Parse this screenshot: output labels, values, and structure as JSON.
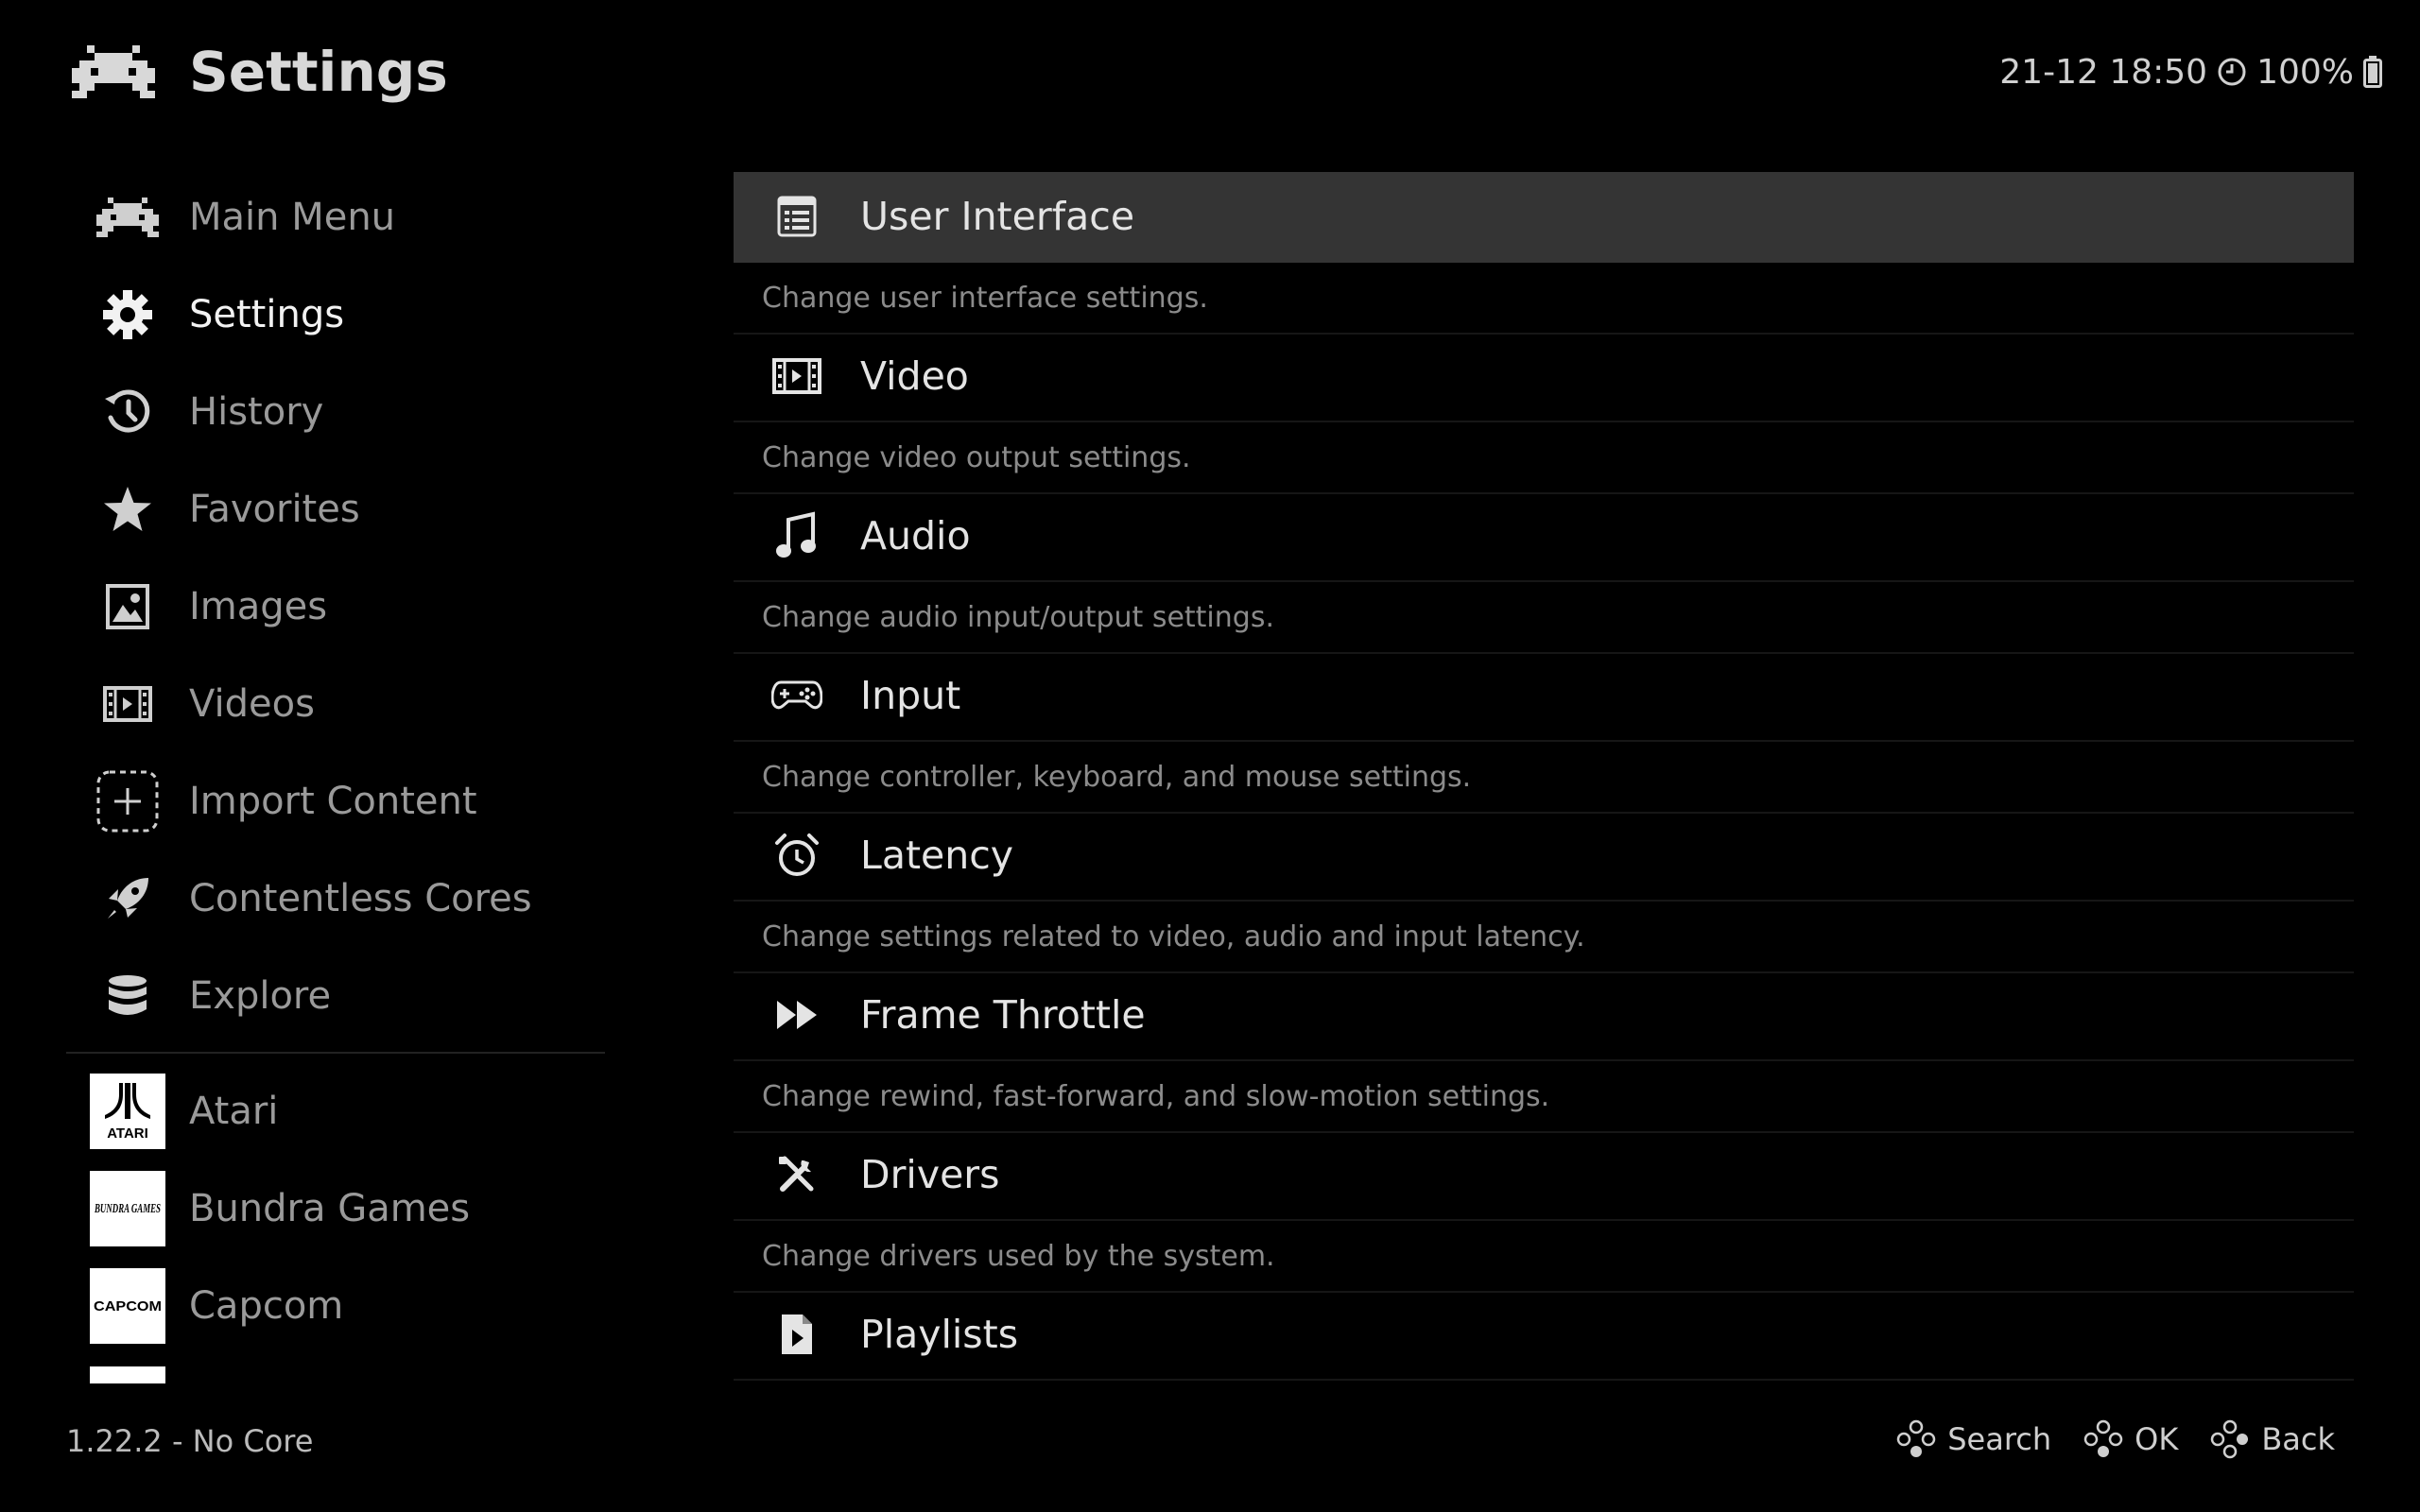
{
  "header": {
    "title": "Settings",
    "datetime": "21-12 18:50",
    "battery": "100%"
  },
  "sidebar": {
    "items": [
      {
        "label": "Main Menu",
        "icon": "invader-icon",
        "active": false
      },
      {
        "label": "Settings",
        "icon": "gear-icon",
        "active": true
      },
      {
        "label": "History",
        "icon": "history-icon",
        "active": false
      },
      {
        "label": "Favorites",
        "icon": "star-icon",
        "active": false
      },
      {
        "label": "Images",
        "icon": "image-icon",
        "active": false
      },
      {
        "label": "Videos",
        "icon": "film-icon",
        "active": false
      },
      {
        "label": "Import Content",
        "icon": "plus-icon",
        "active": false
      },
      {
        "label": "Contentless Cores",
        "icon": "rocket-icon",
        "active": false
      },
      {
        "label": "Explore",
        "icon": "database-icon",
        "active": false
      }
    ],
    "playlists": [
      {
        "label": "Atari",
        "logo_text": "ATARI",
        "icon": "atari-logo-icon"
      },
      {
        "label": "Bundra Games",
        "logo_text": "BUNDRA GAMES",
        "icon": "bundra-logo-icon"
      },
      {
        "label": "Capcom",
        "logo_text": "CAPCOM",
        "icon": "capcom-logo-icon"
      }
    ]
  },
  "menu": {
    "items": [
      {
        "label": "User Interface",
        "description": "Change user interface settings.",
        "icon": "ui-list-icon",
        "selected": true
      },
      {
        "label": "Video",
        "description": "Change video output settings.",
        "icon": "film-icon",
        "selected": false
      },
      {
        "label": "Audio",
        "description": "Change audio input/output settings.",
        "icon": "music-note-icon",
        "selected": false
      },
      {
        "label": "Input",
        "description": "Change controller, keyboard, and mouse settings.",
        "icon": "gamepad-icon",
        "selected": false
      },
      {
        "label": "Latency",
        "description": "Change settings related to video, audio and input latency.",
        "icon": "alarm-clock-icon",
        "selected": false
      },
      {
        "label": "Frame Throttle",
        "description": "Change rewind, fast-forward, and slow-motion settings.",
        "icon": "fast-forward-icon",
        "selected": false
      },
      {
        "label": "Drivers",
        "description": "Change drivers used by the system.",
        "icon": "tools-icon",
        "selected": false
      },
      {
        "label": "Playlists",
        "icon": "playlist-file-icon",
        "selected": false
      }
    ]
  },
  "footer": {
    "version": "1.22.2 - No Core",
    "hints": [
      {
        "label": "Search",
        "icon": "gamepad-buttons-icon"
      },
      {
        "label": "OK",
        "icon": "gamepad-buttons-icon"
      },
      {
        "label": "Back",
        "icon": "gamepad-buttons-icon"
      }
    ]
  },
  "colors": {
    "background": "#000000",
    "selection": "#343434",
    "text_active": "#f2f2f2",
    "text_inactive": "#9a9a9a",
    "description": "#8b8b8b"
  }
}
